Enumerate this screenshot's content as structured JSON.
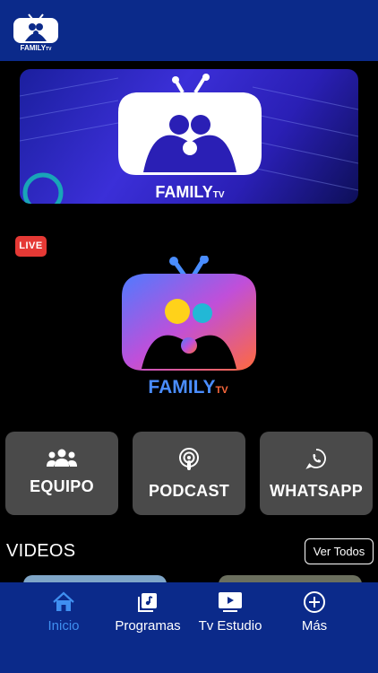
{
  "top_bar": {
    "logo_text": "FAMILY",
    "logo_suffix": "TV"
  },
  "banner": {
    "logo_text": "FAMILY",
    "logo_suffix": "TV"
  },
  "live": {
    "badge": "LIVE",
    "logo_text": "FAMILY",
    "logo_suffix": "TV"
  },
  "actions": [
    {
      "label": "EQUIPO",
      "icon": "people-icon"
    },
    {
      "label": "PODCAST",
      "icon": "podcast-icon"
    },
    {
      "label": "WHATSAPP",
      "icon": "whatsapp-icon"
    }
  ],
  "videos": {
    "title": "VIDEOS",
    "see_all": "Ver Todos"
  },
  "nav": [
    {
      "label": "Inicio",
      "icon": "home-icon",
      "active": true
    },
    {
      "label": "Programas",
      "icon": "programs-icon",
      "active": false
    },
    {
      "label": "Tv  Estudio",
      "icon": "tv-play-icon",
      "active": false
    },
    {
      "label": "Más",
      "icon": "plus-circle-icon",
      "active": false
    }
  ],
  "colors": {
    "bar": "#0b2a8a",
    "accent": "#3f8ff0",
    "card": "#4a4a4a",
    "live": "#e53935"
  }
}
